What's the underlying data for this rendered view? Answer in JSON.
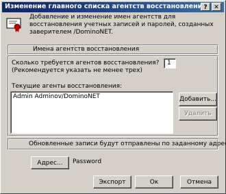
{
  "window": {
    "title": "Изменение главного списка агентств восстановления",
    "help_btn": "?",
    "close_btn": "✕"
  },
  "description": "Добавление и изменение имен агентств для восстановления учетных записей и паролей, созданных заверителем /DominoNET.",
  "agents_group": {
    "label": "Имена агентств восстановления",
    "count_question": "Сколько требуется агентов восстановления?",
    "count_value": "1",
    "count_hint": "(Рекомендуется указать не менее трех)",
    "list_label": "Текущие агенты восстановления:",
    "list_items": [
      "Admin Adminov/DominoNET"
    ],
    "add_button": "Добавить...",
    "remove_button": "Удалить"
  },
  "send_group": {
    "notice": "Обновленные записи будут отправлены по заданному адресу",
    "address_button": "Адрес...",
    "address_value": "Password"
  },
  "footer": {
    "export_button": "Экспорт",
    "ok_button": "Ок",
    "cancel_button": "Отмена"
  }
}
